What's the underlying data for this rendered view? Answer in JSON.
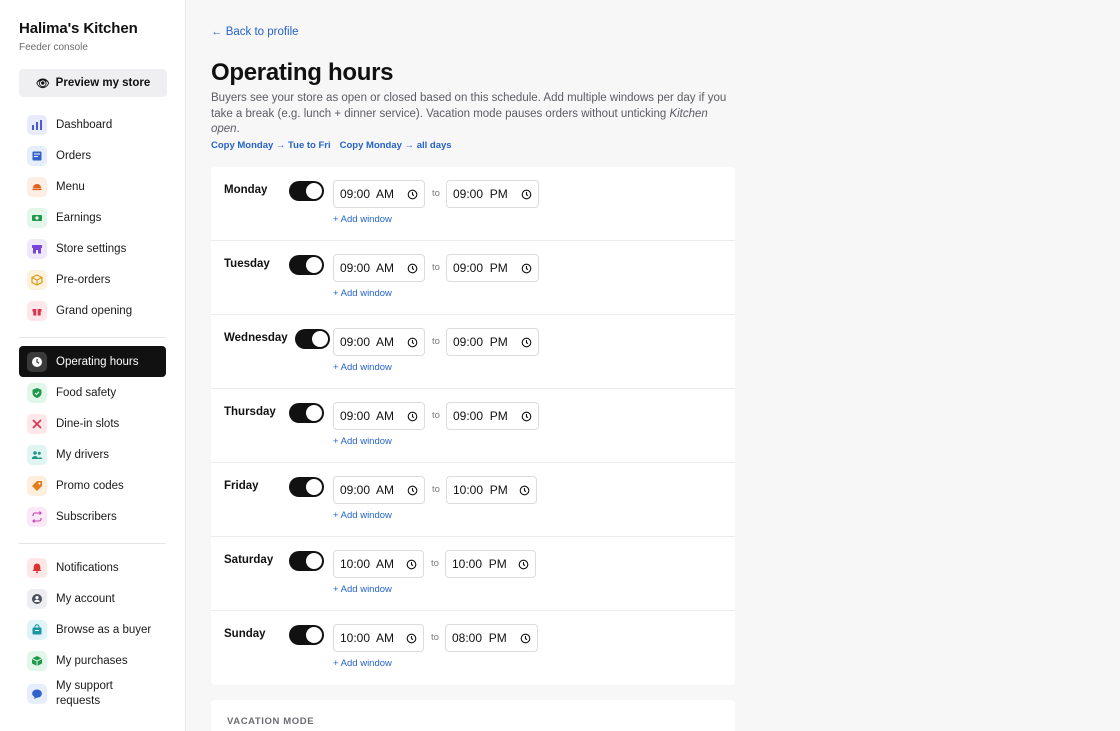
{
  "brand": {
    "title": "Halima's Kitchen",
    "subtitle": "Feeder console"
  },
  "preview_button": {
    "label": "Preview my store",
    "icon": "eye-icon"
  },
  "nav_primary": [
    {
      "label": "Dashboard",
      "icon": "dashboard-icon",
      "bg": "#e8ebfa",
      "fg": "#4a5bd6"
    },
    {
      "label": "Orders",
      "icon": "orders-icon",
      "bg": "#e6eefb",
      "fg": "#2f63c9"
    },
    {
      "label": "Menu",
      "icon": "menu-icon",
      "bg": "#fdeee3",
      "fg": "#e0601f"
    },
    {
      "label": "Earnings",
      "icon": "earnings-icon",
      "bg": "#e3f6ea",
      "fg": "#1f9a4d"
    },
    {
      "label": "Store settings",
      "icon": "store-icon",
      "bg": "#efe8fb",
      "fg": "#7a45d6"
    },
    {
      "label": "Pre-orders",
      "icon": "box-icon",
      "bg": "#fdf3dc",
      "fg": "#d79a1a"
    },
    {
      "label": "Grand opening",
      "icon": "gift-icon",
      "bg": "#fde7ea",
      "fg": "#d9344f"
    }
  ],
  "nav_secondary": [
    {
      "label": "Operating hours",
      "icon": "clock-icon",
      "active": true
    },
    {
      "label": "Food safety",
      "icon": "shield-icon",
      "bg": "#e3f6ea",
      "fg": "#1f9a4d"
    },
    {
      "label": "Dine-in slots",
      "icon": "utensils-icon",
      "bg": "#fde7ea",
      "fg": "#d9344f"
    },
    {
      "label": "My drivers",
      "icon": "drivers-icon",
      "bg": "#e0f5f1",
      "fg": "#1a9a86"
    },
    {
      "label": "Promo codes",
      "icon": "tag-icon",
      "bg": "#fdeedd",
      "fg": "#e07f1f"
    },
    {
      "label": "Subscribers",
      "icon": "repeat-icon",
      "bg": "#fbe8f6",
      "fg": "#c53aae"
    }
  ],
  "nav_tertiary": [
    {
      "label": "Notifications",
      "icon": "bell-icon",
      "bg": "#fde7e7",
      "fg": "#d93434"
    },
    {
      "label": "My account",
      "icon": "user-icon",
      "bg": "#eceef2",
      "fg": "#4a5060"
    },
    {
      "label": "Browse as a buyer",
      "icon": "bag-icon",
      "bg": "#e0f4f7",
      "fg": "#1a95a8"
    },
    {
      "label": "My purchases",
      "icon": "package-icon",
      "bg": "#e3f6ea",
      "fg": "#1f9a4d"
    },
    {
      "label": "My support requests",
      "icon": "chat-icon",
      "bg": "#e6eefb",
      "fg": "#2f63c9"
    }
  ],
  "back_link": "← Back to profile",
  "page": {
    "title": "Operating hours",
    "description": "Buyers see your store as open or closed based on this schedule. Add multiple windows per day if you take a break (e.g. lunch + dinner service). Vacation mode pauses orders without unticking ",
    "description_em": "Kitchen open",
    "description_end": "."
  },
  "copy_links": [
    "Copy Monday → Tue to Fri",
    "Copy Monday → all days"
  ],
  "days": [
    {
      "name": "Monday",
      "enabled": true,
      "from": "09:00  AM",
      "to": "09:00  PM"
    },
    {
      "name": "Tuesday",
      "enabled": true,
      "from": "09:00  AM",
      "to": "09:00  PM"
    },
    {
      "name": "Wednesday",
      "enabled": true,
      "from": "09:00  AM",
      "to": "09:00  PM"
    },
    {
      "name": "Thursday",
      "enabled": true,
      "from": "09:00  AM",
      "to": "09:00  PM"
    },
    {
      "name": "Friday",
      "enabled": true,
      "from": "09:00  AM",
      "to": "10:00  PM"
    },
    {
      "name": "Saturday",
      "enabled": true,
      "from": "10:00  AM",
      "to": "10:00  PM"
    },
    {
      "name": "Sunday",
      "enabled": true,
      "from": "10:00  AM",
      "to": "08:00  PM"
    }
  ],
  "to_label": "to",
  "add_window_label": "+ Add window",
  "vacation": {
    "title": "VACATION MODE"
  },
  "colors": {
    "accent": "#2563c9",
    "active_nav": "#111111"
  }
}
